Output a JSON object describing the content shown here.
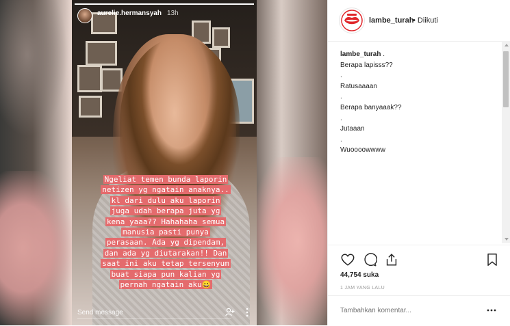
{
  "story": {
    "username": "aurelie.hermansyah",
    "time": "13h",
    "progress": 1.0,
    "caption_lines": [
      "Ngeliat temen bunda laporin",
      "netizen yg ngatain anaknya..",
      "kl dari dulu aku laporin",
      "juga udah berapa juta yg",
      "kena yaaa?? Hahahaha semua",
      "manusia pasti punya",
      "perasaan. Ada yg dipendam,",
      "dan ada yg diutarakan!! Dan",
      "saat ini aku tetap tersenyum",
      "buat siapa pun kalian yg",
      "pernah ngatain aku😀"
    ],
    "send_message_placeholder": "Send message",
    "share_icon": "add-person-icon",
    "more_icon": "vertical-dots-icon"
  },
  "post": {
    "username": "lambe_turah",
    "follow_status": "• Diikuti",
    "avatar_icon": "red-lips-logo",
    "comment": {
      "username": "lambe_turah",
      "lines": [
        " .",
        "Berapa lapisss??",
        ".",
        "Ratusaaaan",
        ".",
        "Berapa banyaaak??",
        ".",
        "Jutaaan",
        ".",
        "Wuoooowwww"
      ]
    },
    "likes": "44,754 suka",
    "time": "1 JAM YANG LALU",
    "comment_placeholder": "Tambahkan komentar...",
    "icons": {
      "like": "heart-icon",
      "comment": "comment-bubble-icon",
      "share": "share-icon",
      "save": "bookmark-icon",
      "more": "horizontal-dots-icon"
    }
  },
  "colors": {
    "caption_highlight": "#e46b6d",
    "brand_red": "#e0262a"
  }
}
